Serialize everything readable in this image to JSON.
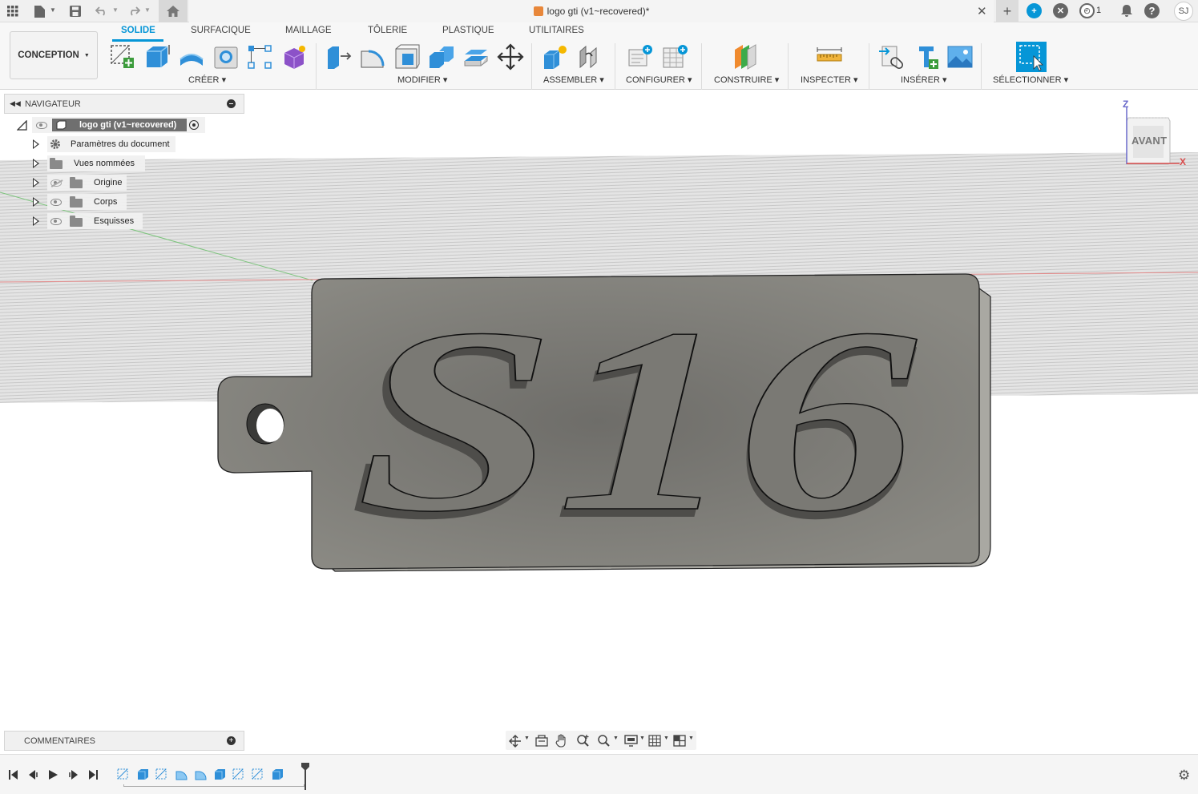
{
  "titlebar": {
    "document_title": "logo gti (v1~recovered)*",
    "notifications_count": "1",
    "user_initials": "SJ",
    "icons": [
      "grid-icon",
      "file-icon",
      "save-icon",
      "undo-icon",
      "redo-icon",
      "home-icon",
      "close-icon",
      "plus-icon",
      "extensions-icon",
      "offline-icon",
      "job-status-icon",
      "notifications-icon",
      "help-icon"
    ]
  },
  "ribbon": {
    "workspace": "CONCEPTION",
    "tabs": [
      {
        "label": "SOLIDE",
        "active": true
      },
      {
        "label": "SURFACIQUE",
        "active": false
      },
      {
        "label": "MAILLAGE",
        "active": false
      },
      {
        "label": "TÔLERIE",
        "active": false
      },
      {
        "label": "PLASTIQUE",
        "active": false
      },
      {
        "label": "UTILITAIRES",
        "active": false
      }
    ],
    "groups": [
      {
        "label": "CRÉER"
      },
      {
        "label": "MODIFIER"
      },
      {
        "label": "ASSEMBLER"
      },
      {
        "label": "CONFIGURER"
      },
      {
        "label": "CONSTRUIRE"
      },
      {
        "label": "INSPECTER"
      },
      {
        "label": "INSÉRER"
      },
      {
        "label": "SÉLECTIONNER"
      }
    ],
    "accent_color": "#0696d7"
  },
  "navigator": {
    "title": "NAVIGATEUR",
    "root": "logo gti (v1~recovered)",
    "items": [
      {
        "label": "Paramètres du document",
        "icon": "gear-icon"
      },
      {
        "label": "Vues nommées",
        "icon": "folder-icon"
      },
      {
        "label": "Origine",
        "icon": "folder-icon",
        "visibility": "hidden"
      },
      {
        "label": "Corps",
        "icon": "folder-icon",
        "visibility": "visible"
      },
      {
        "label": "Esquisses",
        "icon": "folder-icon",
        "visibility": "visible"
      }
    ]
  },
  "viewport": {
    "model_text": "S16",
    "viewcube_face": "AVANT",
    "axis_z": "Z",
    "axis_x": "X"
  },
  "comments": {
    "title": "COMMENTAIRES"
  },
  "timeline": {
    "features": [
      "sketch",
      "extrude",
      "sketch",
      "fillet",
      "fillet",
      "extrude",
      "sketch",
      "sketch",
      "extrude"
    ]
  }
}
